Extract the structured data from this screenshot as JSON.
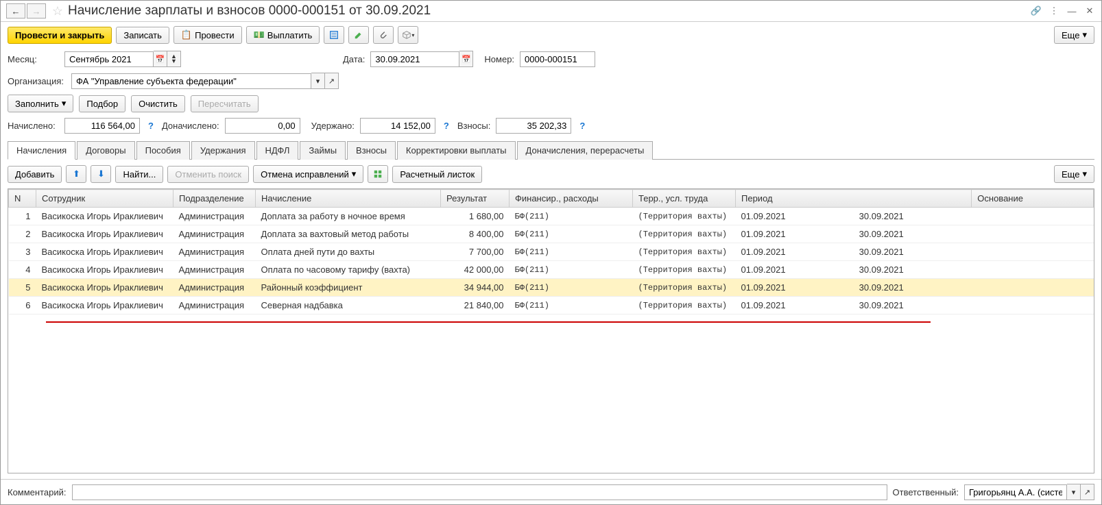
{
  "title": "Начисление зарплаты и взносов 0000-000151 от 30.09.2021",
  "toolbar": {
    "post_close": "Провести и закрыть",
    "save": "Записать",
    "post": "Провести",
    "pay": "Выплатить",
    "more": "Еще"
  },
  "fields": {
    "month_label": "Месяц:",
    "month_value": "Сентябрь 2021",
    "date_label": "Дата:",
    "date_value": "30.09.2021",
    "number_label": "Номер:",
    "number_value": "0000-000151",
    "org_label": "Организация:",
    "org_value": "ФА \"Управление субъекта федерации\""
  },
  "actions": {
    "fill": "Заполнить",
    "pick": "Подбор",
    "clear": "Очистить",
    "recalc": "Пересчитать"
  },
  "totals": {
    "accrued_label": "Начислено:",
    "accrued_value": "116 564,00",
    "extra_label": "Доначислено:",
    "extra_value": "0,00",
    "withheld_label": "Удержано:",
    "withheld_value": "14 152,00",
    "contrib_label": "Взносы:",
    "contrib_value": "35 202,33"
  },
  "tabs": [
    "Начисления",
    "Договоры",
    "Пособия",
    "Удержания",
    "НДФЛ",
    "Займы",
    "Взносы",
    "Корректировки выплаты",
    "Доначисления, перерасчеты"
  ],
  "tab_toolbar": {
    "add": "Добавить",
    "find": "Найти...",
    "cancel_search": "Отменить поиск",
    "cancel_corr": "Отмена исправлений",
    "payslip": "Расчетный листок",
    "more": "Еще"
  },
  "columns": {
    "n": "N",
    "employee": "Сотрудник",
    "department": "Подразделение",
    "accrual": "Начисление",
    "result": "Результат",
    "financing": "Финансир., расходы",
    "territory": "Терр., усл. труда",
    "period": "Период",
    "basis": "Основание"
  },
  "rows": [
    {
      "n": "1",
      "emp": "Васикоска Игорь Ираклиевич",
      "dept": "Администрация",
      "accr": "Доплата за работу в ночное время",
      "res": "1 680,00",
      "fin": "БФ(211)",
      "terr": "(Территория вахты)",
      "p1": "01.09.2021",
      "p2": "30.09.2021"
    },
    {
      "n": "2",
      "emp": "Васикоска Игорь Ираклиевич",
      "dept": "Администрация",
      "accr": "Доплата за вахтовый метод работы",
      "res": "8 400,00",
      "fin": "БФ(211)",
      "terr": "(Территория вахты)",
      "p1": "01.09.2021",
      "p2": "30.09.2021"
    },
    {
      "n": "3",
      "emp": "Васикоска Игорь Ираклиевич",
      "dept": "Администрация",
      "accr": "Оплата дней пути до вахты",
      "res": "7 700,00",
      "fin": "БФ(211)",
      "terr": "(Территория вахты)",
      "p1": "01.09.2021",
      "p2": "30.09.2021"
    },
    {
      "n": "4",
      "emp": "Васикоска Игорь Ираклиевич",
      "dept": "Администрация",
      "accr": "Оплата по часовому тарифу (вахта)",
      "res": "42 000,00",
      "fin": "БФ(211)",
      "terr": "(Территория вахты)",
      "p1": "01.09.2021",
      "p2": "30.09.2021"
    },
    {
      "n": "5",
      "emp": "Васикоска Игорь Ираклиевич",
      "dept": "Администрация",
      "accr": "Районный коэффициент",
      "res": "34 944,00",
      "fin": "БФ(211)",
      "terr": "(Территория вахты)",
      "p1": "01.09.2021",
      "p2": "30.09.2021"
    },
    {
      "n": "6",
      "emp": "Васикоска Игорь Ираклиевич",
      "dept": "Администрация",
      "accr": "Северная надбавка",
      "res": "21 840,00",
      "fin": "БФ(211)",
      "terr": "(Территория вахты)",
      "p1": "01.09.2021",
      "p2": "30.09.2021"
    }
  ],
  "selected_row": 4,
  "footer": {
    "comment_label": "Комментарий:",
    "responsible_label": "Ответственный:",
    "responsible_value": "Григорьянц А.А. (системн"
  }
}
